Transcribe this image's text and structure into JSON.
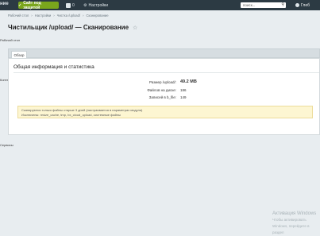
{
  "topbar": {
    "left_text": "ние",
    "site_button": "Сайт под защитой",
    "counter": "0",
    "settings": "Настройки",
    "search_placeholder": "поиск...",
    "user": "Глеб"
  },
  "breadcrumb": [
    "Рабочий стол",
    "Настройки",
    "Чистка /upload/",
    "Сканирование"
  ],
  "page": {
    "title": "Чистильщик /upload/ — Сканирование"
  },
  "left_edge": [
    "Рабочий стол",
    "Контент",
    "Сервисы"
  ],
  "tabs": [
    {
      "label": "Обзор"
    }
  ],
  "panel": {
    "heading": "Общая информация и статистика",
    "stats": [
      {
        "label": "Размер /upload/:",
        "value": "49.2 MB"
      },
      {
        "label": "Файлов на диске:",
        "value": "186"
      },
      {
        "label": "Записей в b_file:",
        "value": "149"
      }
    ],
    "notice_lines": [
      "Сканируются только файлы старше 3 дней (настраивается в параметрах модуля)",
      "Исключены: resize_cache, tmp, bx_cloud_upload, системные файлы"
    ]
  },
  "watermark": {
    "line1": "Активация Windows",
    "line2": "Чтобы активировать Windows, перейдите в раздел"
  },
  "colors": {
    "topbar_bg": "#2c3a43",
    "site_button_bg": "#7aa61c",
    "page_bg": "#e8edf0",
    "notice_bg": "#fdf6d2"
  }
}
